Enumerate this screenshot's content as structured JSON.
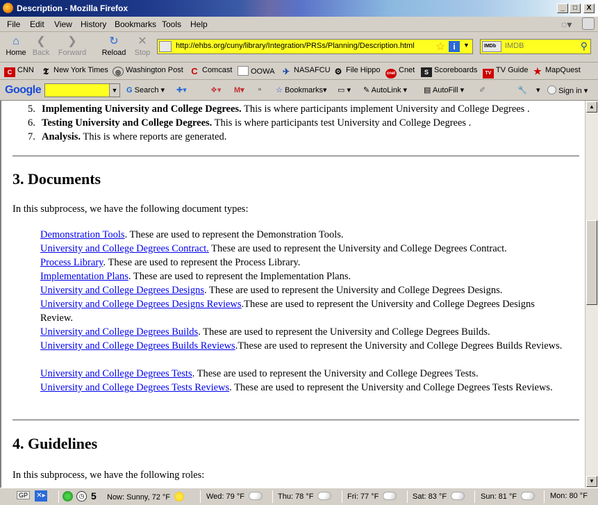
{
  "window": {
    "title": "Description - Mozilla Firefox",
    "minimize": "_",
    "maximize": "□",
    "close": "X"
  },
  "menu": [
    "File",
    "Edit",
    "View",
    "History",
    "Bookmarks",
    "Tools",
    "Help"
  ],
  "nav": {
    "home": "Home",
    "back": "Back",
    "forward": "Forward",
    "reload": "Reload",
    "stop": "Stop",
    "url": "http://ehbs.org/cuny/library/Integration/PRSs/Planning/Description.html",
    "search_engine": "IMDb",
    "search_placeholder": "IMDB"
  },
  "bookmarks": [
    "CNN",
    "New York Times",
    "Washington Post",
    "Comcast",
    "OOWA",
    "NASAFCU",
    "File Hippo",
    "Cnet",
    "Scoreboards",
    "TV Guide",
    "MapQuest"
  ],
  "google_toolbar": {
    "logo": "Google",
    "search": "Search",
    "bookmarks": "Bookmarks",
    "autolink": "AutoLink",
    "autofill": "AutoFill",
    "signin": "Sign in"
  },
  "page": {
    "list_items": [
      {
        "num": "5.",
        "title": "Implementing University and College Degrees.",
        "text": " This is where participants implement University and College Degrees ."
      },
      {
        "num": "6.",
        "title": "Testing University and College Degrees.",
        "text": " This is where participants test University and College Degrees ."
      },
      {
        "num": "7.",
        "title": "Analysis.",
        "text": " This is where reports are generated."
      }
    ],
    "documents_heading": "3. Documents",
    "documents_intro": "In this subprocess, we have the following document types:",
    "documents": [
      {
        "link": "Demonstration Tools",
        "text": ". These are used to represent the Demonstration Tools."
      },
      {
        "link": "University and College Degrees Contract.",
        "text": " These are used to represent the University and College Degrees Contract."
      },
      {
        "link": "Process Library",
        "text": ". These are used to represent the Process Library."
      },
      {
        "link": "Implementation Plans",
        "text": ". These are used to represent the Implementation Plans."
      },
      {
        "link": "University and College Degrees Designs",
        "text": ". These are used to represent the University and College Degrees Designs."
      },
      {
        "link": "University and College Degrees Designs Reviews",
        "text": ".These are used to represent the University and College Degrees Designs Review."
      },
      {
        "link": "University and College Degrees Builds",
        "text": ". These are used to represent the University and College Degrees Builds."
      },
      {
        "link": "University and College Degrees Builds Reviews",
        "text": ".These are used to represent the University and College Degrees Builds Reviews."
      },
      {
        "link": "University and College Degrees Tests",
        "text": ". These are used to represent the University and College Degrees Tests."
      },
      {
        "link": "University and College Degrees Tests Reviews",
        "text": ". These are used to represent the University and College Degrees Tests Reviews."
      }
    ],
    "guidelines_heading": "4. Guidelines",
    "guidelines_intro": "In this subprocess, we have the following roles:"
  },
  "status": {
    "gp": "GP",
    "count": "5",
    "now": "Now: Sunny, 72 °F",
    "wed": "Wed: 79 °F",
    "thu": "Thu: 78 °F",
    "fri": "Fri: 77 °F",
    "sat": "Sat: 83 °F",
    "sun": "Sun: 81 °F",
    "mon": "Mon: 80 °F"
  },
  "colors": {
    "url_bg": "#ffff22",
    "link": "#0000ee",
    "title_bar": "#0a246a"
  }
}
